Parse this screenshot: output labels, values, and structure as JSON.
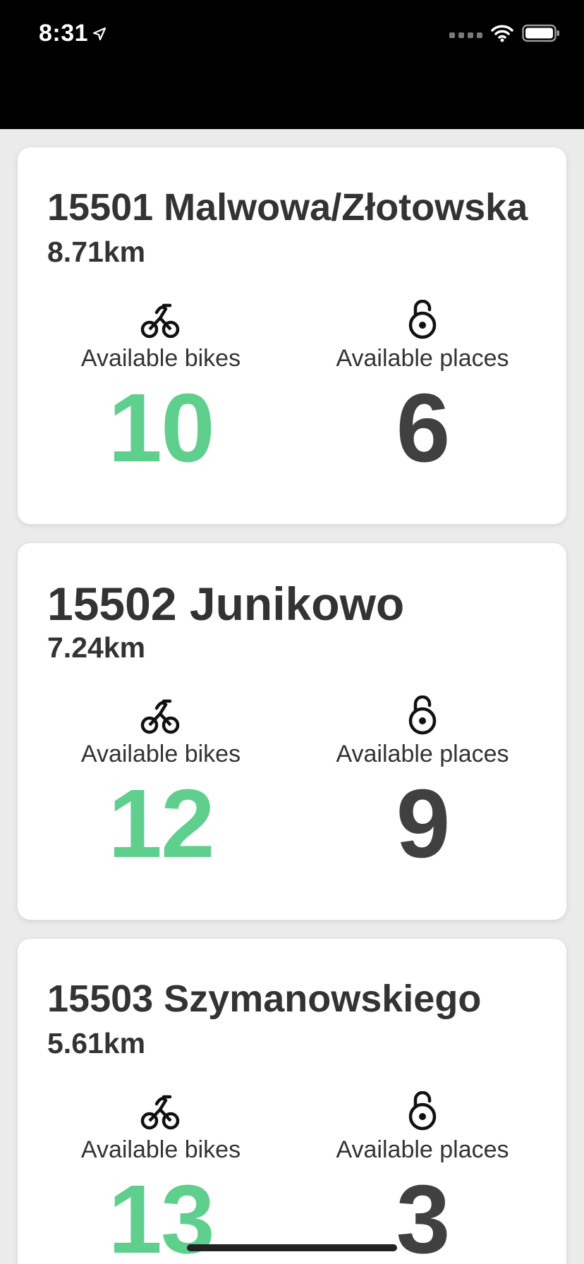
{
  "status_bar": {
    "time": "8:31"
  },
  "colors": {
    "bikes_accent": "#5fcf8e",
    "places_text": "#404040",
    "title_text": "#333333"
  },
  "stations": [
    {
      "name": "15501 Malwowa/Złotowska",
      "distance": "8.71km",
      "bikes_label": "Available bikes",
      "bikes_count": "10",
      "places_label": "Available places",
      "places_count": "6"
    },
    {
      "name": "15502 Junikowo",
      "distance": "7.24km",
      "bikes_label": "Available bikes",
      "bikes_count": "12",
      "places_label": "Available places",
      "places_count": "9"
    },
    {
      "name": "15503 Szymanowskiego",
      "distance": "5.61km",
      "bikes_label": "Available bikes",
      "bikes_count": "13",
      "places_label": "Available places",
      "places_count": "3"
    }
  ],
  "icons": {
    "bike": "bicycle-icon",
    "lock": "padlock-open-icon"
  }
}
